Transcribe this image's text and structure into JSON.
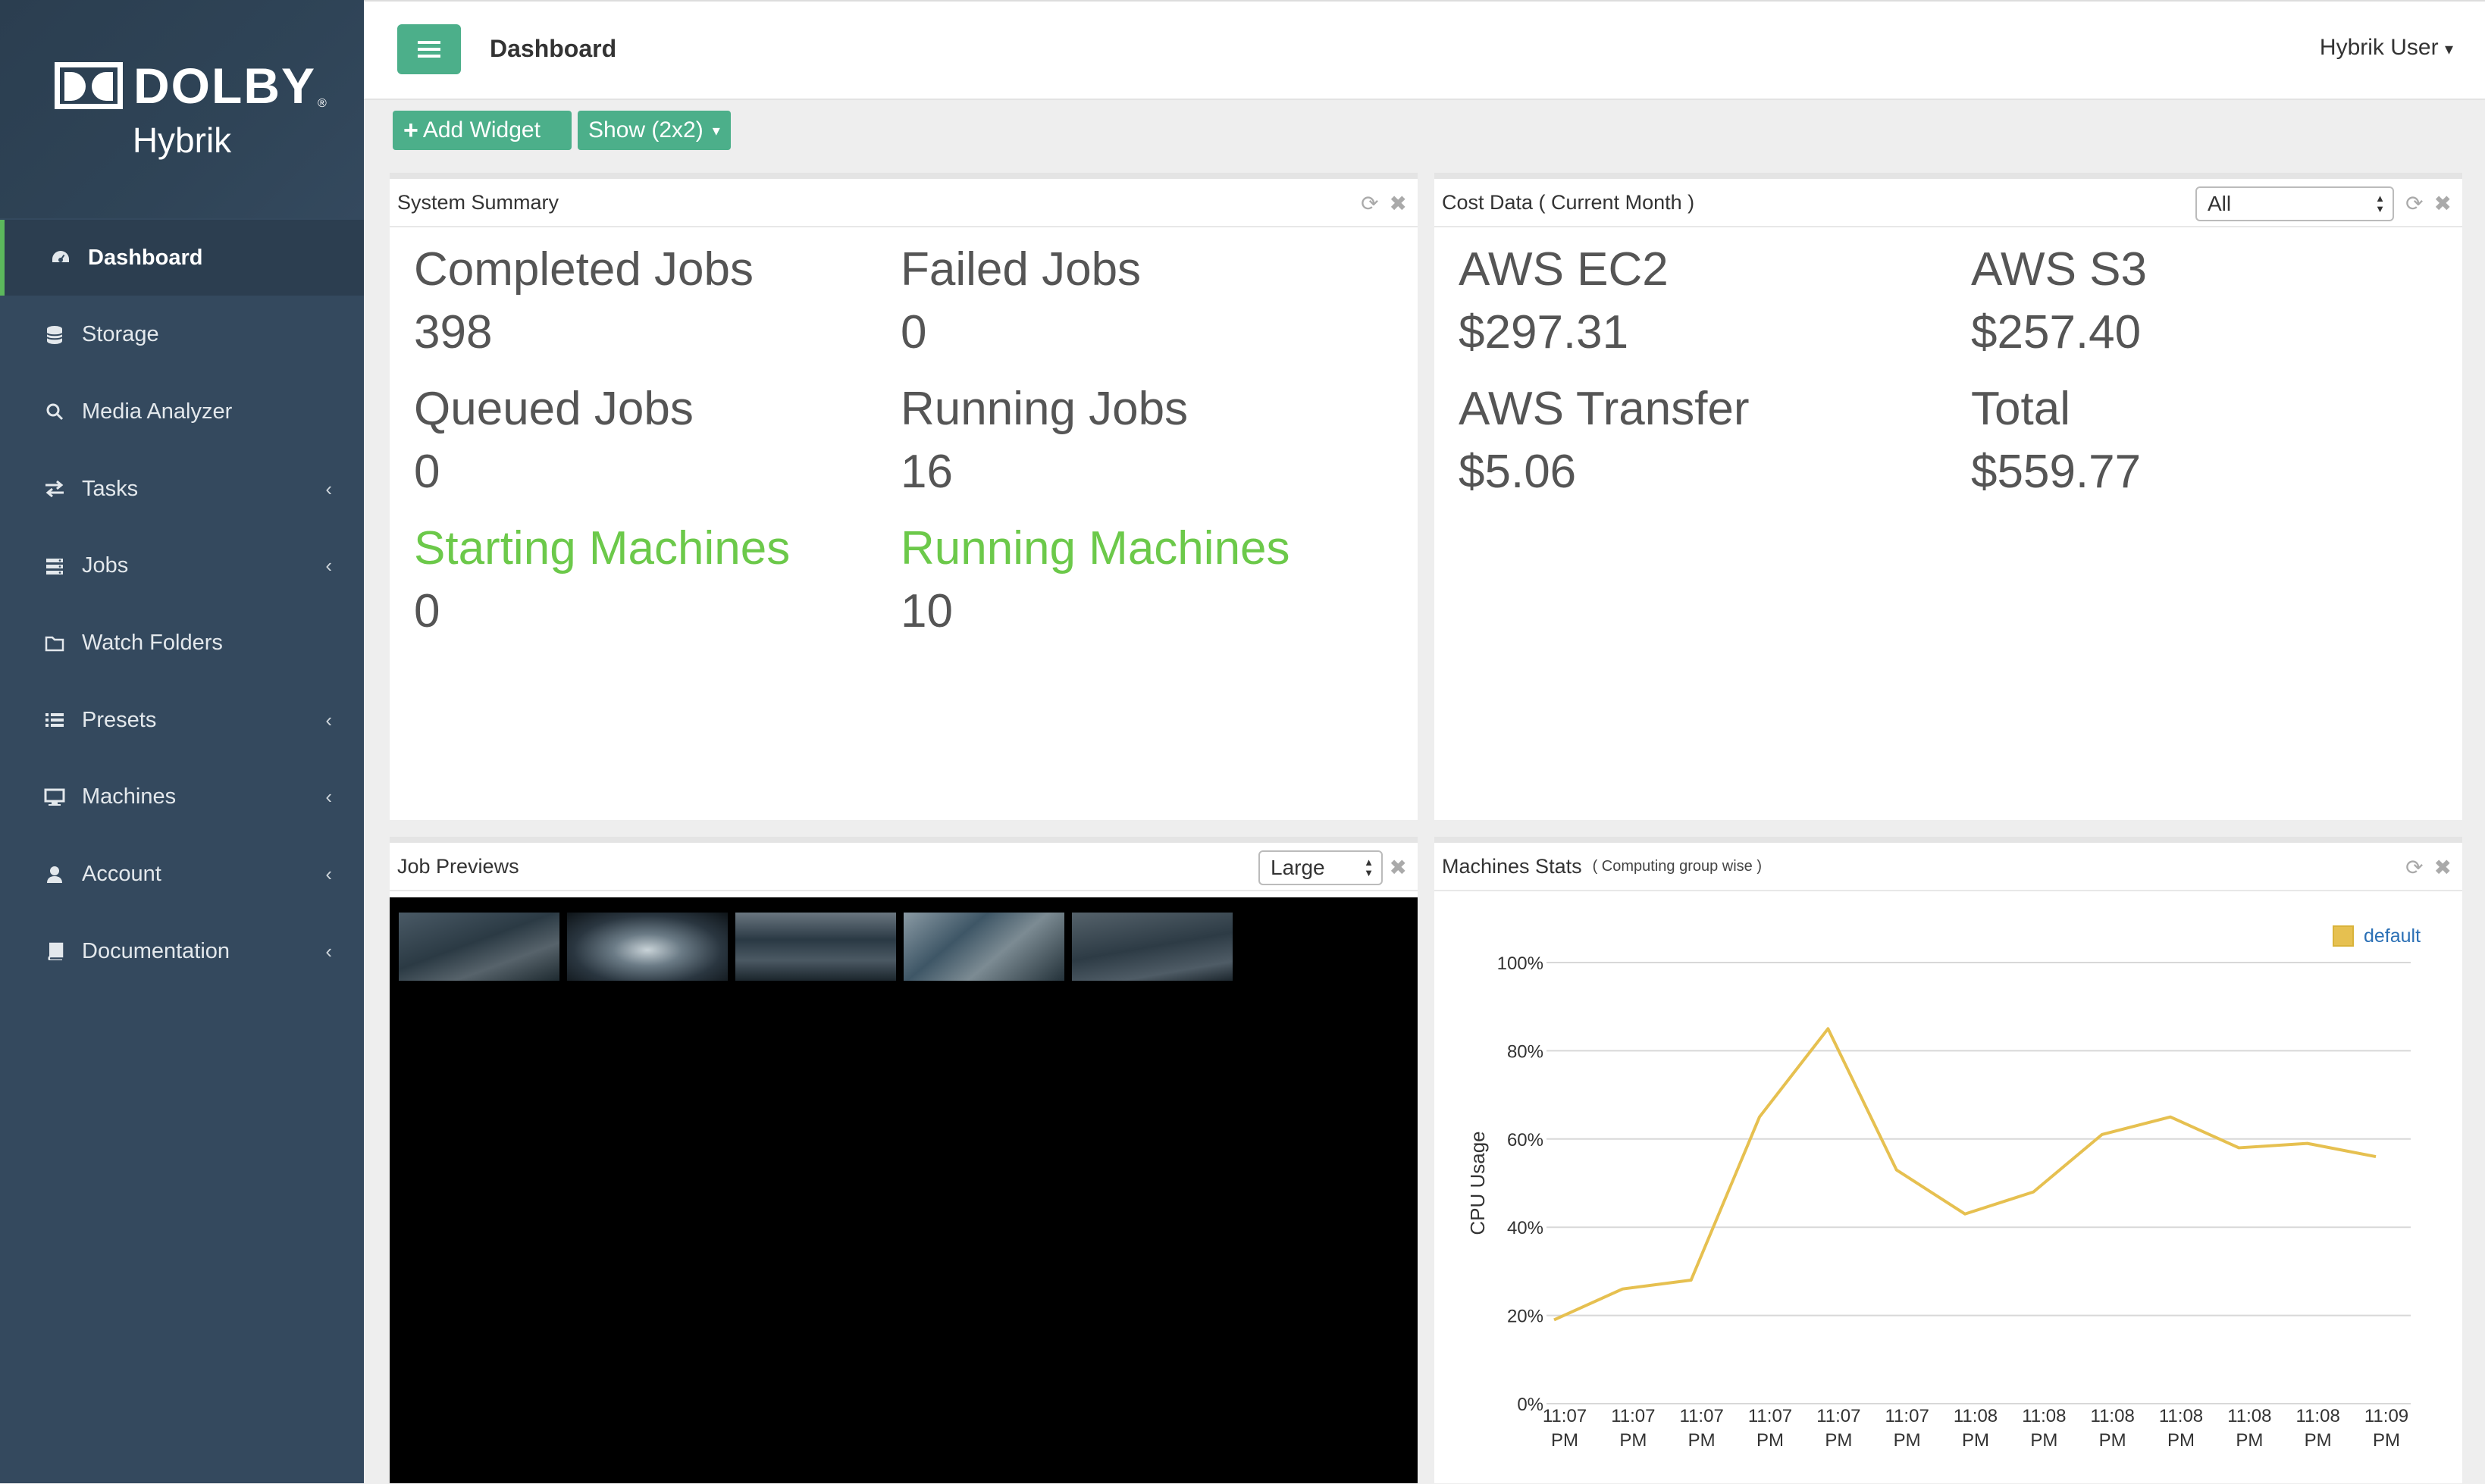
{
  "brand": {
    "name": "DOLBY",
    "reg": "®",
    "product": "Hybrik"
  },
  "sidebar": {
    "items": [
      {
        "label": "Dashboard",
        "icon": "dashboard-icon",
        "active": true,
        "chevron": false
      },
      {
        "label": "Storage",
        "icon": "database-icon",
        "active": false,
        "chevron": false
      },
      {
        "label": "Media Analyzer",
        "icon": "search-icon",
        "active": false,
        "chevron": false
      },
      {
        "label": "Tasks",
        "icon": "exchange-icon",
        "active": false,
        "chevron": true
      },
      {
        "label": "Jobs",
        "icon": "jobs-icon",
        "active": false,
        "chevron": true
      },
      {
        "label": "Watch Folders",
        "icon": "folder-icon",
        "active": false,
        "chevron": false
      },
      {
        "label": "Presets",
        "icon": "list-icon",
        "active": false,
        "chevron": true
      },
      {
        "label": "Machines",
        "icon": "desktop-icon",
        "active": false,
        "chevron": true
      },
      {
        "label": "Account",
        "icon": "user-icon",
        "active": false,
        "chevron": true
      },
      {
        "label": "Documentation",
        "icon": "book-icon",
        "active": false,
        "chevron": true
      }
    ],
    "chevron": "‹"
  },
  "header": {
    "title": "Dashboard",
    "user": "Hybrik User",
    "user_caret": "▾"
  },
  "toolbar": {
    "add_widget": "Add Widget",
    "show_layout": "Show (2x2)",
    "caret": "▾"
  },
  "system_summary": {
    "title": "System Summary",
    "stats": [
      {
        "label": "Completed Jobs",
        "value": "398",
        "highlight": false
      },
      {
        "label": "Failed Jobs",
        "value": "0",
        "highlight": false
      },
      {
        "label": "Queued Jobs",
        "value": "0",
        "highlight": false
      },
      {
        "label": "Running Jobs",
        "value": "16",
        "highlight": false
      },
      {
        "label": "Starting Machines",
        "value": "0",
        "highlight": true
      },
      {
        "label": "Running Machines",
        "value": "10",
        "highlight": true
      }
    ]
  },
  "cost_data": {
    "title": "Cost Data ( Current Month )",
    "filter": "All",
    "stats": [
      {
        "label": "AWS EC2",
        "value": "$297.31"
      },
      {
        "label": "AWS S3",
        "value": "$257.40"
      },
      {
        "label": "AWS Transfer",
        "value": "$5.06"
      },
      {
        "label": "Total",
        "value": "$559.77"
      }
    ]
  },
  "job_previews": {
    "title": "Job Previews",
    "size": "Large",
    "thumbnail_count": 5
  },
  "machines_stats": {
    "title": "Machines Stats",
    "subtitle": "( Computing group wise )"
  },
  "chart_data": {
    "type": "line",
    "ylabel": "CPU Usage",
    "xlabel": "",
    "ylim": [
      0,
      100
    ],
    "yticks": [
      "0%",
      "20%",
      "40%",
      "60%",
      "80%",
      "100%"
    ],
    "x": [
      "11:07 PM",
      "11:07 PM",
      "11:07 PM",
      "11:07 PM",
      "11:07 PM",
      "11:07 PM",
      "11:08 PM",
      "11:08 PM",
      "11:08 PM",
      "11:08 PM",
      "11:08 PM",
      "11:08 PM",
      "11:09 PM"
    ],
    "series": [
      {
        "name": "default",
        "color": "#e6c050",
        "values": [
          19,
          26,
          28,
          65,
          85,
          53,
          43,
          48,
          61,
          65,
          58,
          59,
          56
        ]
      }
    ],
    "legend": "top-right",
    "grid": true
  },
  "colors": {
    "accent": "#4caf8a",
    "highlight": "#6cc94a",
    "sidebar": "#34495e"
  }
}
